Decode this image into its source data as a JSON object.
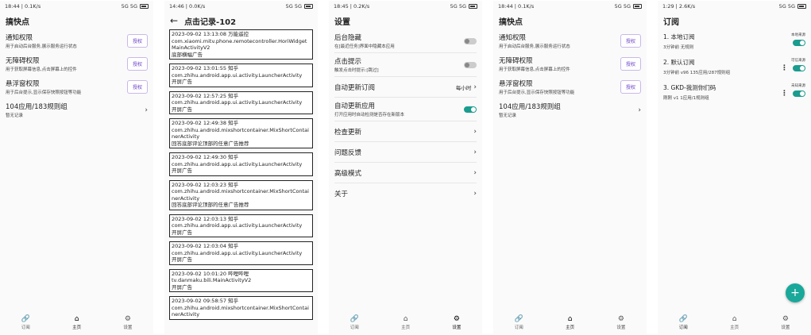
{
  "screens": {
    "home1": {
      "status_time": "18:44 | 0.1K/s",
      "status_signal": "5G 5G",
      "title": "搞快点",
      "items": [
        {
          "title": "通知权限",
          "desc": "用于启动后台服务,展示服务运行状态",
          "btn": "授权"
        },
        {
          "title": "无障碍权限",
          "desc": "用于获取屏幕信息,点击屏幕上的控件",
          "btn": "授权"
        },
        {
          "title": "悬浮窗权限",
          "desc": "用于后台提示,显示保存快照按钮等功能",
          "btn": "授权"
        }
      ],
      "rules": {
        "title": "104应用/183规则组",
        "desc": "暂无记录"
      }
    },
    "clicks": {
      "status_time": "14:46 | 0.0K/s",
      "status_signal": "5G 5G",
      "title": "点击记录-102",
      "logs": [
        {
          "time": "2023-09-02 13:13:08 万能遥控",
          "activity": "com.xiaomi.mitv.phone.remotecontroller.HoriWidgetMainActivityV2",
          "rule": "底部横幅广告"
        },
        {
          "time": "2023-09-02 13:01:55 知乎",
          "activity": "com.zhihu.android.app.ui.activity.LauncherActivity",
          "rule": "开屏广告"
        },
        {
          "time": "2023-09-02 12:57:25 知乎",
          "activity": "com.zhihu.android.app.ui.activity.LauncherActivity",
          "rule": "开屏广告"
        },
        {
          "time": "2023-09-02 12:49:38 知乎",
          "activity": "com.zhihu.android.mixshortcontainer.MixShortContainerActivity",
          "rule": "回答底部评论顶部的任意广告推荐"
        },
        {
          "time": "2023-09-02 12:49:30 知乎",
          "activity": "com.zhihu.android.app.ui.activity.LauncherActivity",
          "rule": "开屏广告"
        },
        {
          "time": "2023-09-02 12:03:23 知乎",
          "activity": "com.zhihu.android.mixshortcontainer.MixShortContainerActivity",
          "rule": "回答底部评论顶部的任意广告推荐"
        },
        {
          "time": "2023-09-02 12:03:13 知乎",
          "activity": "com.zhihu.android.app.ui.activity.LauncherActivity",
          "rule": "开屏广告"
        },
        {
          "time": "2023-09-02 12:03:04 知乎",
          "activity": "com.zhihu.android.app.ui.activity.LauncherActivity",
          "rule": "开屏广告"
        },
        {
          "time": "2023-09-02 10:01:20 哔哩哔哩",
          "activity": "tv.danmaku.bili.MainActivityV2",
          "rule": "开屏广告"
        },
        {
          "time": "2023-09-02 09:58:57 知乎",
          "activity": "com.zhihu.android.mixshortcontainer.MixShortContainerActivity",
          "rule": ""
        }
      ]
    },
    "settings": {
      "status_time": "18:45 | 0.2K/s",
      "status_signal": "5G 5G",
      "title": "设置",
      "hide_bg": {
        "title": "后台隐藏",
        "desc": "在[最近任务]界面中隐藏本应用"
      },
      "click_hint": {
        "title": "点击提示",
        "desc": "触发点击时提示:[跳过]"
      },
      "auto_update_sub": {
        "title": "自动更新订阅",
        "value": "每小时"
      },
      "auto_update_app": {
        "title": "自动更新应用",
        "desc": "打开应用时自动检测是否存在新版本"
      },
      "menu": [
        "检查更新",
        "问题反馈",
        "高级模式",
        "关于"
      ]
    },
    "home2": {
      "status_time": "18:44 | 0.1K/s",
      "status_signal": "5G 5G",
      "title": "搞快点",
      "items": [
        {
          "title": "通知权限",
          "desc": "用于启动后台服务,展示服务运行状态",
          "btn": "授权"
        },
        {
          "title": "无障碍权限",
          "desc": "用于获取屏幕信息,点击屏幕上的控件",
          "btn": "授权"
        },
        {
          "title": "悬浮窗权限",
          "desc": "用于后台提示,显示保存快照按钮等功能",
          "btn": "授权"
        }
      ],
      "rules": {
        "title": "104应用/183规则组",
        "desc": "暂无记录"
      }
    },
    "subs": {
      "status_time": "1:29 | 2.6K/s",
      "status_signal": "5G 5G",
      "title": "订阅",
      "items": [
        {
          "title": "1. 本地订阅",
          "desc": "3分钟前  无规则",
          "tag": "本地来源"
        },
        {
          "title": "2. 默认订阅",
          "desc": "3分钟前  v96  135应用/287规则组",
          "tag": "可信来源"
        },
        {
          "title": "3. GKD-我测你们码",
          "desc": "刚刚  v1  1应用/1规则组",
          "tag": "未知来源"
        }
      ],
      "fab": "+"
    }
  },
  "nav": {
    "sub": "订阅",
    "home": "主页",
    "settings": "设置"
  }
}
